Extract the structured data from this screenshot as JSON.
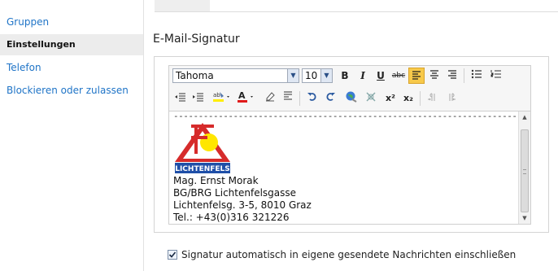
{
  "sidebar": {
    "items": [
      {
        "label": "Gruppen",
        "selected": false
      },
      {
        "label": "Einstellungen",
        "selected": true
      },
      {
        "label": "Telefon",
        "selected": false
      },
      {
        "label": "Blockieren oder zulassen",
        "selected": false
      }
    ]
  },
  "main": {
    "section_title": "E-Mail-Signatur"
  },
  "toolbar": {
    "font_family": "Tahoma",
    "font_size": "10",
    "bold": "B",
    "italic": "I",
    "underline": "U",
    "strikethrough": "abc",
    "superscript": "x²",
    "subscript": "x₂"
  },
  "signature": {
    "separator": "----------------------------------------------------------------------------------------------------",
    "logo_text": "LICHTENFELS",
    "lines": [
      "Mag. Ernst Morak",
      "BG/BRG Lichtenfelsgasse",
      "Lichtenfelsg. 3-5, 8010 Graz",
      "Tel.: +43(0)316 321226"
    ]
  },
  "option": {
    "label": "Signatur automatisch in eigene gesendete Nachrichten einschließen",
    "checked": true
  },
  "colors": {
    "link": "#1f74c7",
    "active_button": "#f7c94a",
    "logo_red": "#d62b2b",
    "logo_yellow": "#ffe600",
    "logo_blue": "#1f4fa8"
  }
}
